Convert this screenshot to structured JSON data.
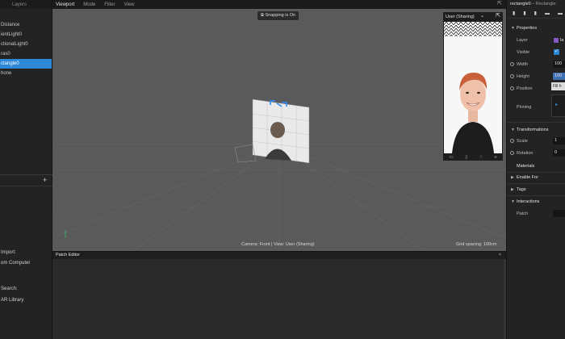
{
  "left_panel": {
    "tabs": [
      "Layers"
    ],
    "scene_items": [
      "Distance",
      "ientLight0",
      "ctionalLight0",
      "ras0",
      "ctangle0",
      "hone"
    ],
    "selected_index": 4,
    "import_label": "Import:",
    "from_computer": "om Computer",
    "search_label": "Search:",
    "library_label": "AR Library",
    "add_symbol": "+"
  },
  "topbar": {
    "menus": [
      "Viewport",
      "Mode",
      "Filter",
      "View"
    ]
  },
  "viewport": {
    "snapping": "Snapping is On",
    "camera_info": "Camera: Front | View: User (Sharing)",
    "grid_spacing": "Grid spacing: 100cm"
  },
  "simulator": {
    "device_label": "User (Sharing)"
  },
  "patch_editor": {
    "title": "Patch Editor",
    "close": "×"
  },
  "inspector": {
    "object_name": "rectangle0",
    "object_type": "– Rectangle",
    "sections": {
      "properties": "Properties",
      "transformations": "Transformations",
      "materials": "Materials",
      "enable_for": "Enable For",
      "tags": "Tags",
      "interactions": "Interactions"
    },
    "props": {
      "layer": "Layer",
      "layer_value": "la",
      "visible": "Visible",
      "width": "Width",
      "width_value": "100",
      "height": "Height",
      "height_value": "100",
      "fill_hint": "Fill h",
      "position": "Position",
      "pinning": "Pinning",
      "scale": "Scale",
      "scale_value": "1",
      "rotation": "Rotation",
      "rotation_value": "0",
      "patch": "Patch"
    }
  },
  "colors": {
    "accent": "#2d88d8",
    "viewport_bg": "#5a5a5a",
    "panel_bg": "#232323"
  }
}
